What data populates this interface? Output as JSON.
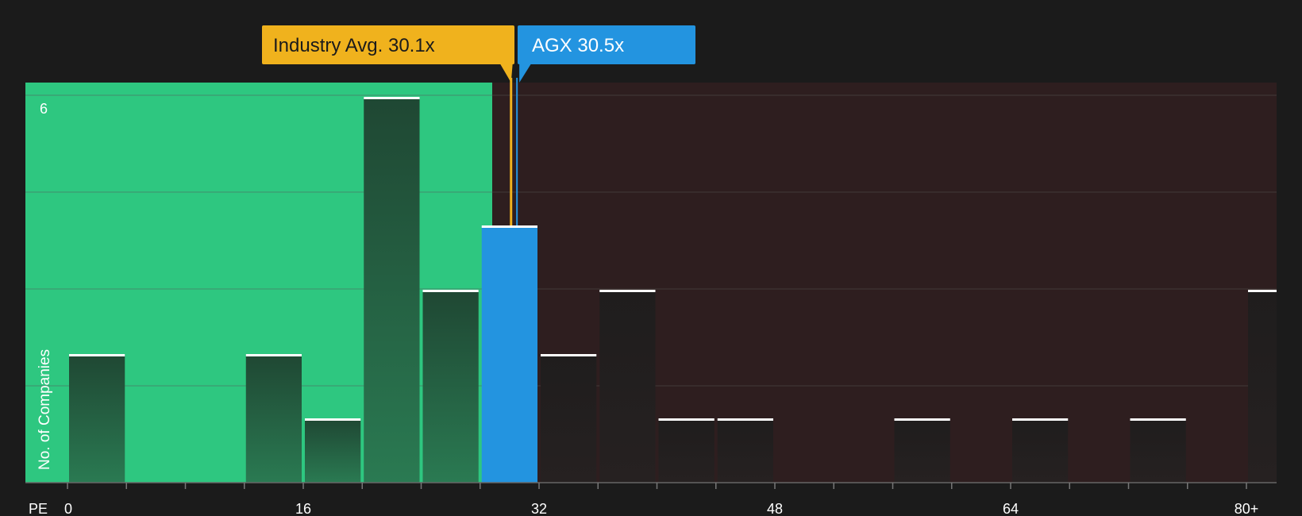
{
  "chart_data": {
    "type": "bar",
    "xlabel": "PE",
    "ylabel": "No. of Companies",
    "x_ticks": [
      "0",
      "16",
      "32",
      "48",
      "64",
      "80+"
    ],
    "x_tick_values": [
      0,
      16,
      32,
      48,
      64,
      80
    ],
    "y_ticks": [
      6
    ],
    "ylim": [
      0,
      6
    ],
    "xlim": [
      0,
      81
    ],
    "grid": true,
    "bin_width": 4,
    "bins": [
      {
        "start": 0,
        "value": 2
      },
      {
        "start": 12,
        "value": 2
      },
      {
        "start": 16,
        "value": 1
      },
      {
        "start": 20,
        "value": 6
      },
      {
        "start": 24,
        "value": 3
      },
      {
        "start": 28,
        "value": 4,
        "highlight": true
      },
      {
        "start": 32,
        "value": 2
      },
      {
        "start": 36,
        "value": 3
      },
      {
        "start": 40,
        "value": 1
      },
      {
        "start": 44,
        "value": 1
      },
      {
        "start": 56,
        "value": 1
      },
      {
        "start": 64,
        "value": 1
      },
      {
        "start": 72,
        "value": 1
      },
      {
        "start": 80,
        "value": 3
      }
    ],
    "industry_avg": {
      "label": "Industry Avg. 30.1x",
      "value": 30.1
    },
    "company": {
      "label": "AGX 30.5x",
      "value": 30.5
    },
    "colors": {
      "background": "#1b1b1b",
      "undervalued_zone": "#2ec780",
      "overvalued_zone": "#2e1e1f",
      "bar_in_green": "#24593c",
      "bar_in_red": "#231f1f",
      "highlight_bar": "#2394e0",
      "industry_marker": "#f0b21d",
      "company_marker": "#2394e0",
      "bar_cap": "#ffffff",
      "gridline": "#565656",
      "text": "#ffffff",
      "industry_text": "#1b1b1b",
      "company_text": "#ffffff"
    }
  }
}
